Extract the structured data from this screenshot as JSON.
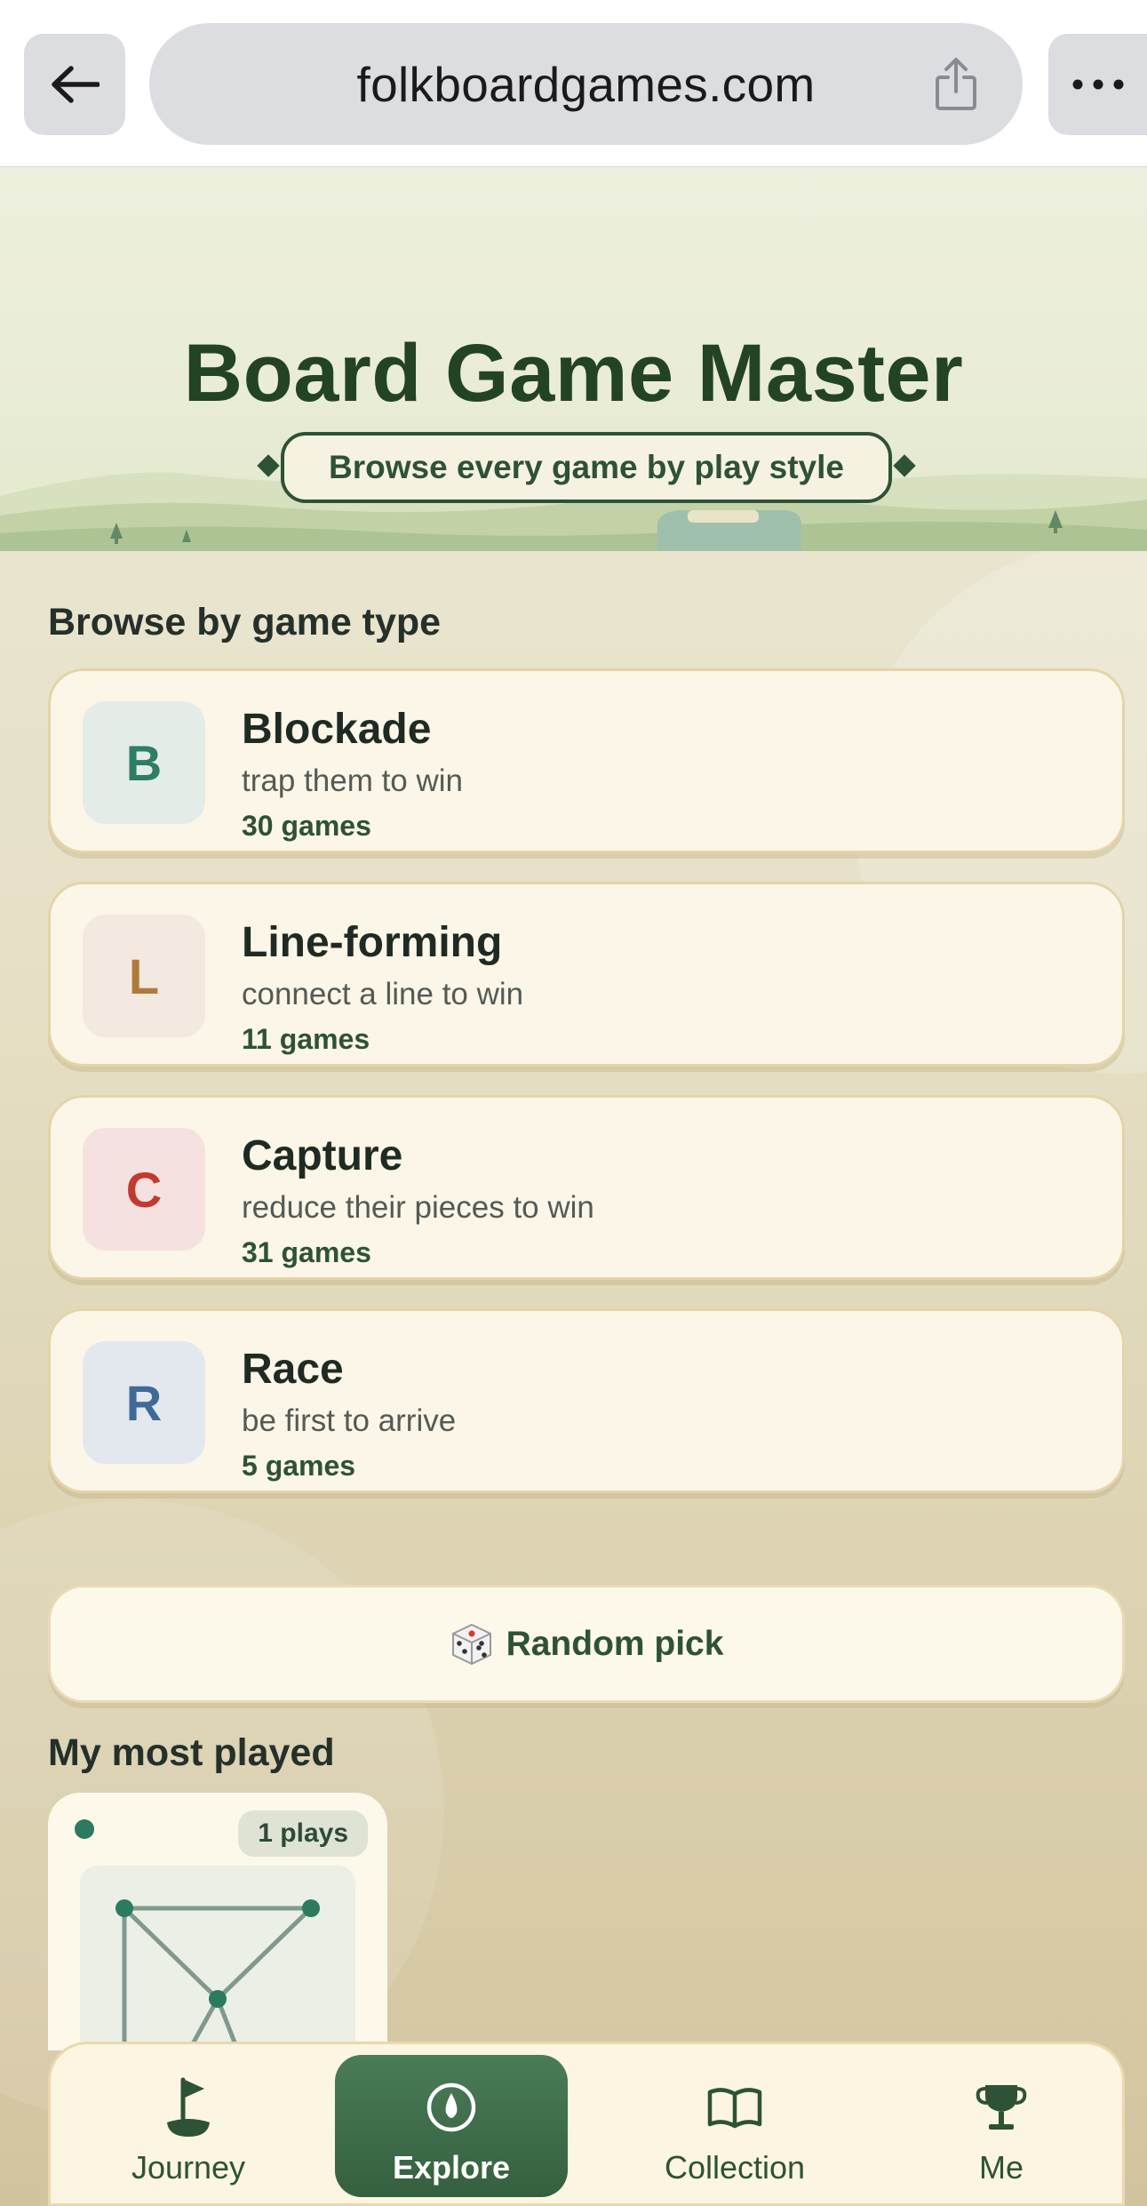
{
  "browser": {
    "url": "folkboardgames.com"
  },
  "hero": {
    "title": "Board Game Master",
    "subtitle": "Browse every game by play style"
  },
  "categories_section": {
    "heading": "Browse by game type",
    "items": [
      {
        "letter": "B",
        "name": "Blockade",
        "description": "trap them to win",
        "count": "30 games",
        "accent": "#2e7d67",
        "tile_bg": "#e3ece6"
      },
      {
        "letter": "L",
        "name": "Line-forming",
        "description": "connect a line to win",
        "count": "11 games",
        "accent": "#b07a3a",
        "tile_bg": "#f3e9e0"
      },
      {
        "letter": "C",
        "name": "Capture",
        "description": "reduce their pieces to win",
        "count": "31 games",
        "accent": "#c23a2f",
        "tile_bg": "#f5e1df"
      },
      {
        "letter": "R",
        "name": "Race",
        "description": "be first to arrive",
        "count": "5 games",
        "accent": "#3f6a98",
        "tile_bg": "#e3e8ee"
      }
    ]
  },
  "random_pick": {
    "label": "Random pick",
    "icon": "dice-icon"
  },
  "most_played": {
    "heading": "My most played",
    "items": [
      {
        "plays": "1 plays"
      }
    ]
  },
  "bottom_nav": {
    "items": [
      {
        "label": "Journey",
        "icon": "golf-flag-icon",
        "active": false
      },
      {
        "label": "Explore",
        "icon": "compass-icon",
        "active": true
      },
      {
        "label": "Collection",
        "icon": "open-book-icon",
        "active": false
      },
      {
        "label": "Me",
        "icon": "trophy-icon",
        "active": false
      }
    ]
  },
  "colors": {
    "brand_green": "#2e5236",
    "active_nav": "#3e6d4b",
    "card_bg": "#fbf6e7"
  }
}
